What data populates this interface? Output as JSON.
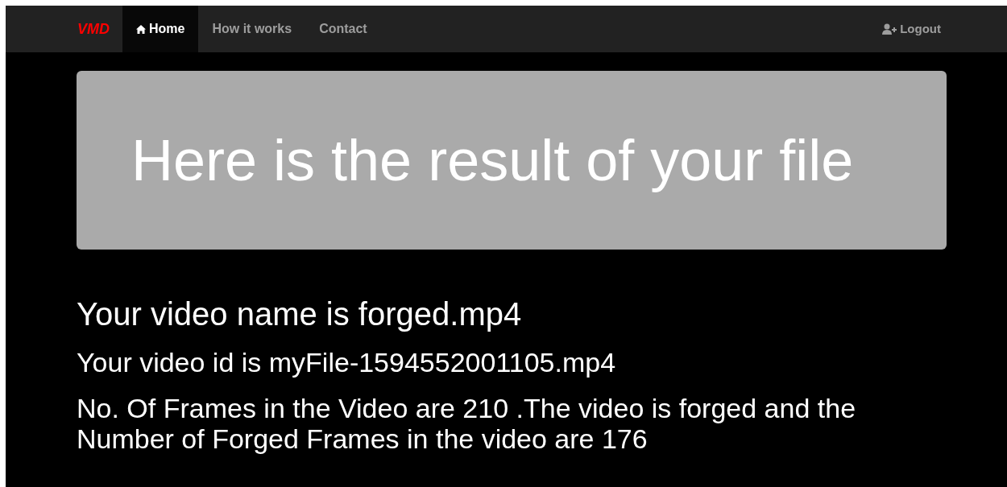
{
  "navbar": {
    "brand": "VMD",
    "links": [
      {
        "label": "Home",
        "selected": true
      },
      {
        "label": "How it works",
        "selected": false
      },
      {
        "label": "Contact",
        "selected": false
      }
    ],
    "logout": "Logout"
  },
  "jumbotron": {
    "heading": "Here is the result of your file"
  },
  "results": {
    "video_name": "Your video name is forged.mp4",
    "video_id": "Your video id is myFile-1594552001105.mp4",
    "summary": "No. Of Frames in the Video are 210 .The video is forged and the Number of Forged Frames in the video are 176"
  }
}
